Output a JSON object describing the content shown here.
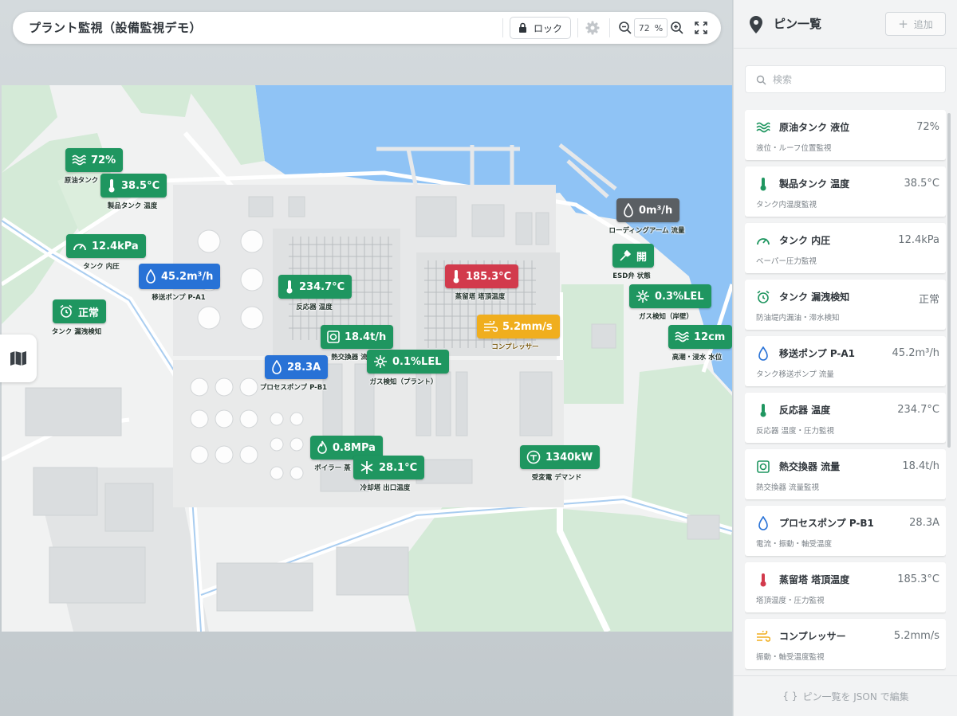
{
  "header": {
    "title": "プラント監視（設備監視デモ）",
    "lock_label": "ロック",
    "zoom_value": "72",
    "zoom_unit": "%"
  },
  "colors": {
    "normal": "#1f9660",
    "info": "#2872d6",
    "alarm": "#d23a4c",
    "warning": "#f0ae1e",
    "offline": "#5a5f63",
    "water": "#8fc3f5",
    "green_area": "#d4ead7"
  },
  "pins": [
    {
      "id": "liquid-level",
      "value": "72%",
      "label": "原油タンク",
      "icon": "wave-icon",
      "status": "normal"
    },
    {
      "id": "product-temp",
      "value": "38.5°C",
      "label": "製品タンク 温度",
      "icon": "thermometer-icon",
      "status": "normal"
    },
    {
      "id": "tank-pressure",
      "value": "12.4kPa",
      "label": "タンク 内圧",
      "icon": "gauge-icon",
      "status": "normal"
    },
    {
      "id": "transfer-pump",
      "value": "45.2m³/h",
      "label": "移送ポンプ P-A1",
      "icon": "drop-icon",
      "status": "info"
    },
    {
      "id": "leak-detect",
      "value": "正常",
      "label": "タンク 漏洩検知",
      "icon": "alarm-clock-icon",
      "status": "normal"
    },
    {
      "id": "reactor-temp",
      "value": "234.7°C",
      "label": "反応器 温度",
      "icon": "thermometer-icon",
      "status": "normal"
    },
    {
      "id": "heat-exchanger",
      "value": "18.4t/h",
      "label": "熱交換器 流",
      "icon": "exchanger-icon",
      "status": "normal"
    },
    {
      "id": "process-pump",
      "value": "28.3A",
      "label": "プロセスポンプ P-B1",
      "icon": "drop-icon",
      "status": "info"
    },
    {
      "id": "gas-plant",
      "value": "0.1%LEL",
      "label": "ガス検知（プラント）",
      "icon": "gas-icon",
      "status": "normal"
    },
    {
      "id": "distill-temp",
      "value": "185.3°C",
      "label": "蒸留塔 塔頂温度",
      "icon": "thermometer-icon",
      "status": "alarm"
    },
    {
      "id": "compressor",
      "value": "5.2mm/s",
      "label": "コンプレッサー",
      "icon": "wind-icon",
      "status": "warning"
    },
    {
      "id": "loading-arm",
      "value": "0m³/h",
      "label": "ローディングアーム 流量",
      "icon": "drop-icon",
      "status": "offline"
    },
    {
      "id": "esd-valve",
      "value": "開",
      "label": "ESD弁 状態",
      "icon": "valve-icon",
      "status": "normal"
    },
    {
      "id": "gas-shore",
      "value": "0.3%LEL",
      "label": "ガス検知（岸壁）",
      "icon": "gas-icon",
      "status": "normal"
    },
    {
      "id": "tide-level",
      "value": "12cm",
      "label": "高潮・浸水 水位",
      "icon": "wave-icon",
      "status": "normal"
    },
    {
      "id": "boiler",
      "value": "0.8MPa",
      "label": "ボイラー 蒸",
      "icon": "flame-icon",
      "status": "normal"
    },
    {
      "id": "cooling-tower",
      "value": "28.1°C",
      "label": "冷却塔 出口温度",
      "icon": "snow-icon",
      "status": "normal"
    },
    {
      "id": "substation",
      "value": "1340kW",
      "label": "受変電 デマンド",
      "icon": "meter-icon",
      "status": "normal"
    }
  ],
  "sidebar": {
    "title": "ピン一覧",
    "add_label": "追加",
    "search_placeholder": "検索",
    "footer_label": "ピン一覧を JSON で編集",
    "footer_icon": "{ }",
    "items": [
      {
        "name": "原油タンク 液位",
        "value": "72%",
        "sub": "液位・ルーフ位置監視",
        "icon": "wave-icon",
        "status": "normal"
      },
      {
        "name": "製品タンク 温度",
        "value": "38.5°C",
        "sub": "タンク内温度監視",
        "icon": "thermometer-icon",
        "status": "normal"
      },
      {
        "name": "タンク 内圧",
        "value": "12.4kPa",
        "sub": "ベーパー圧力監視",
        "icon": "gauge-icon",
        "status": "normal"
      },
      {
        "name": "タンク 漏洩検知",
        "value": "正常",
        "sub": "防油堤内漏油・滞水検知",
        "icon": "alarm-clock-icon",
        "status": "normal"
      },
      {
        "name": "移送ポンプ P-A1",
        "value": "45.2m³/h",
        "sub": "タンク移送ポンプ 流量",
        "icon": "drop-icon",
        "status": "info"
      },
      {
        "name": "反応器 温度",
        "value": "234.7°C",
        "sub": "反応器 温度・圧力監視",
        "icon": "thermometer-icon",
        "status": "normal"
      },
      {
        "name": "熱交換器 流量",
        "value": "18.4t/h",
        "sub": "熱交換器 流量監視",
        "icon": "exchanger-icon",
        "status": "normal"
      },
      {
        "name": "プロセスポンプ P-B1",
        "value": "28.3A",
        "sub": "電流・振動・軸受温度",
        "icon": "drop-icon",
        "status": "info"
      },
      {
        "name": "蒸留塔 塔頂温度",
        "value": "185.3°C",
        "sub": "塔頂温度・圧力監視",
        "icon": "thermometer-icon",
        "status": "alarm"
      },
      {
        "name": "コンプレッサー",
        "value": "5.2mm/s",
        "sub": "振動・軸受温度監視",
        "icon": "wind-icon",
        "status": "warning"
      }
    ]
  }
}
